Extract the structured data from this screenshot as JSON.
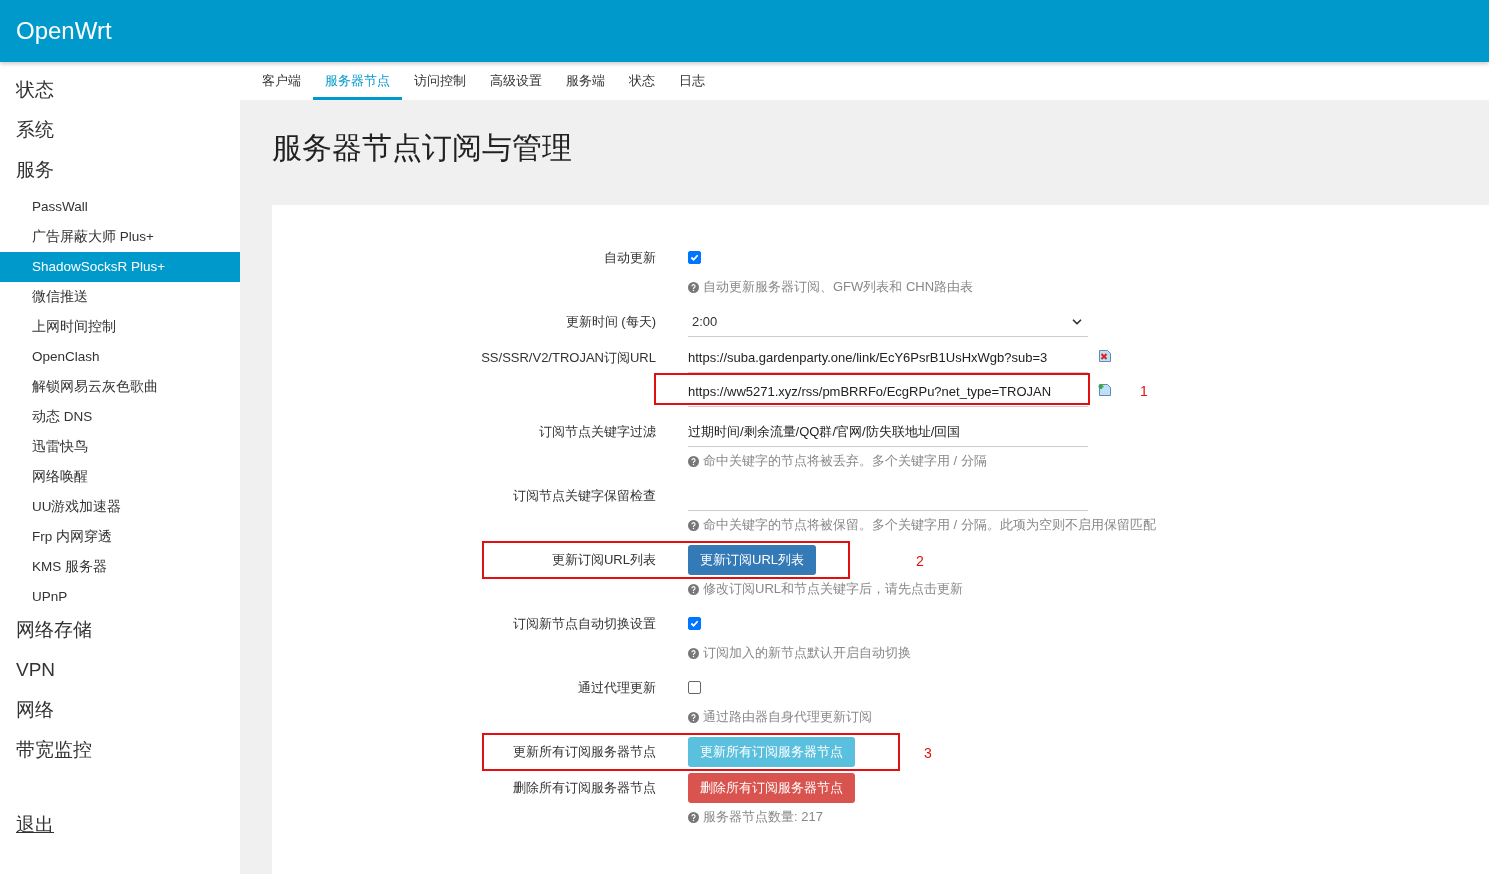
{
  "header": {
    "brand": "OpenWrt"
  },
  "sidebar": {
    "items": [
      {
        "label": "状态",
        "selected": false
      },
      {
        "label": "系统",
        "selected": false
      },
      {
        "label": "服务",
        "selected": false,
        "children": [
          {
            "label": "PassWall",
            "selected": false
          },
          {
            "label": "广告屏蔽大师 Plus+",
            "selected": false
          },
          {
            "label": "ShadowSocksR Plus+",
            "selected": true
          },
          {
            "label": "微信推送",
            "selected": false
          },
          {
            "label": "上网时间控制",
            "selected": false
          },
          {
            "label": "OpenClash",
            "selected": false
          },
          {
            "label": "解锁网易云灰色歌曲",
            "selected": false
          },
          {
            "label": "动态 DNS",
            "selected": false
          },
          {
            "label": "迅雷快鸟",
            "selected": false
          },
          {
            "label": "网络唤醒",
            "selected": false
          },
          {
            "label": "UU游戏加速器",
            "selected": false
          },
          {
            "label": "Frp 内网穿透",
            "selected": false
          },
          {
            "label": "KMS 服务器",
            "selected": false
          },
          {
            "label": "UPnP",
            "selected": false
          }
        ]
      },
      {
        "label": "网络存储",
        "selected": false
      },
      {
        "label": "VPN",
        "selected": false
      },
      {
        "label": "网络",
        "selected": false
      },
      {
        "label": "带宽监控",
        "selected": false
      }
    ],
    "logout": "退出"
  },
  "tabs": [
    {
      "label": "客户端",
      "selected": false
    },
    {
      "label": "服务器节点",
      "selected": true
    },
    {
      "label": "访问控制",
      "selected": false
    },
    {
      "label": "高级设置",
      "selected": false
    },
    {
      "label": "服务端",
      "selected": false
    },
    {
      "label": "状态",
      "selected": false
    },
    {
      "label": "日志",
      "selected": false
    }
  ],
  "page_title": "服务器节点订阅与管理",
  "rows": [
    {
      "kind": "checkbox",
      "label": "自动更新",
      "checked": true,
      "hint": "自动更新服务器订阅、GFW列表和 CHN路由表"
    },
    {
      "kind": "select",
      "label": "更新时间 (每天)",
      "value": "2:00"
    },
    {
      "kind": "list",
      "label": "SS/SSR/V2/TROJAN订阅URL",
      "entries": [
        {
          "value": "https://suba.gardenparty.one/link/EcY6PsrB1UsHxWgb?sub=3"
        },
        {
          "value": "https://ww5271.xyz/rss/pmBRRFo/EcgRPu?net_type=TROJAN",
          "callout": "1"
        }
      ]
    },
    {
      "kind": "text",
      "label": "订阅节点关键字过滤",
      "value": "过期时间/剩余流量/QQ群/官网/防失联地址/回国",
      "hint": "命中关键字的节点将被丢弃。多个关键字用 / 分隔"
    },
    {
      "kind": "text",
      "label": "订阅节点关键字保留检查",
      "hint": "命中关键字的节点将被保留。多个关键字用 / 分隔。此项为空则不启用保留匹配"
    },
    {
      "kind": "button",
      "label": "更新订阅URL列表",
      "button": "更新订阅URL列表",
      "color": "#337ab7",
      "callout": "2",
      "hint": "修改订阅URL和节点关键字后，请先点击更新"
    },
    {
      "kind": "checkbox",
      "label": "订阅新节点自动切换设置",
      "checked": true,
      "hint": "订阅加入的新节点默认开启自动切换"
    },
    {
      "kind": "checkbox",
      "label": "通过代理更新",
      "checked": false,
      "hint": "通过路由器自身代理更新订阅"
    },
    {
      "kind": "button",
      "label": "更新所有订阅服务器节点",
      "button": "更新所有订阅服务器节点",
      "color": "#5bc0de",
      "callout": "3"
    },
    {
      "kind": "button",
      "label": "删除所有订阅服务器节点",
      "button": "删除所有订阅服务器节点",
      "color": "#d9534f",
      "hint": "服务器节点数量: 217"
    }
  ]
}
